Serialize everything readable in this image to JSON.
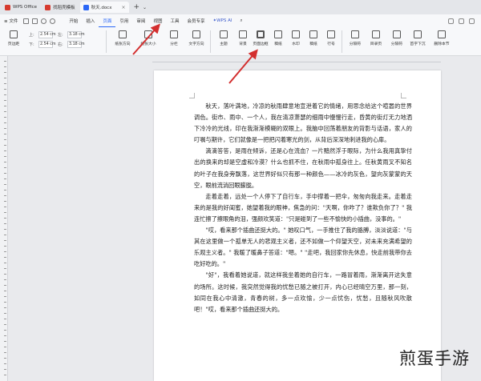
{
  "tabs": [
    {
      "label": "WPS Office",
      "color": "#d63b2f"
    },
    {
      "label": "找稻壳模板",
      "color": "#d63b2f"
    },
    {
      "label": "秋天.docx",
      "color": "#2b67f6",
      "active": true
    }
  ],
  "menubar": {
    "file": "≡ 文件",
    "items": [
      "开始",
      "插入",
      "页面",
      "引用",
      "审阅",
      "视图",
      "工具",
      "会员专享"
    ],
    "active": "页面",
    "wps_ai": "WPS AI"
  },
  "ribbon": {
    "margins": [
      {
        "label": "上:",
        "value": "2.54 cm"
      },
      {
        "label": "下:",
        "value": "2.54 cm"
      },
      {
        "label": "左:",
        "value": "3.18 cm"
      },
      {
        "label": "右:",
        "value": "3.18 cm"
      }
    ],
    "margin_btn": "页边距",
    "buttons": [
      "纸张方向",
      "纸张大小",
      "分栏",
      "文字方向",
      "主题",
      "背景",
      "页面边框",
      "稿纸",
      "水印",
      "稿纸",
      "行号",
      "分隔符",
      "目录页",
      "分隔符",
      "首字下沉",
      "删除本节"
    ]
  },
  "document": {
    "paragraphs": [
      "秋天，落叶满地，冷凉的秋雨肆意地宣泄着它的情绪，用思念给这个喧嚣的世界调色。街市、雨中、一个人，我在清凉萧瑟的细雨中慢慢行走，昏黄的街灯无力地洒下冷冷的光线，印在我渐渐模糊的双眼上。我脑中回荡着朋友的背影与话语，家人的叮嘱与期许，它们就像是一把把闪着寒光的剑，从背后深深地刺进我的心扉。",
      "滴滴答答，是雨在倾诉，还是心在流血？一片黯然浮于眼际，为什么我用真挚付出的换来的却是空虚和冷漠？什么也抓不住，在秋雨中孤身往上。任秋黄雨叉不知名的叶子在我身旁飘落，这世界好似只有那一种颜色——冰冷的灰色，望向灰蒙蒙的天空，眼前流淌回眼朦胧。",
      "走着走着，远处一个人停下了自行车，手中撑着一把伞，匆匆向我走来。走着走来的是我的好闺蜜，她望着我的眼神，焦急的问：\"天啊，你咋了？谁欺负你了？\" 我连忙擦了擦眼角的泪，强颜欢笑道：\"只是碰到了一些不愉快的小插曲，没事的。\"",
      "\"哎，看来那个插曲还挺大的。\" 她叹口气，一手推住了我的胳膊，淡淡说道：\"与其在这里做一个孤单无人的悲观主义者，还不如做一个仰望天空，对未来充满希望的乐观主义者。\" 我暖了暖鼻子答道：\"嗯。\" \"走吧，我回家你先休息，快走前我带你去吃好吃的。\"",
      "\"好\"，我看着她说道，就这样我坐着她的自行车，一路冒着雨，渐渐离开这失意的场所。这时候，我突然觉得我的忧愁已随之被打开，内心已经晴空万里，那一刻，如同在我心中清澈，青春的树，多一点欢愉，少一点忧伤，忧愁，且随秋风吹散吧！\"哎，看来那个插曲还挺大的。"
    ]
  },
  "watermark": "煎蛋手游",
  "colors": {
    "accent": "#2b67f6",
    "arrow": "#d32f2f"
  }
}
